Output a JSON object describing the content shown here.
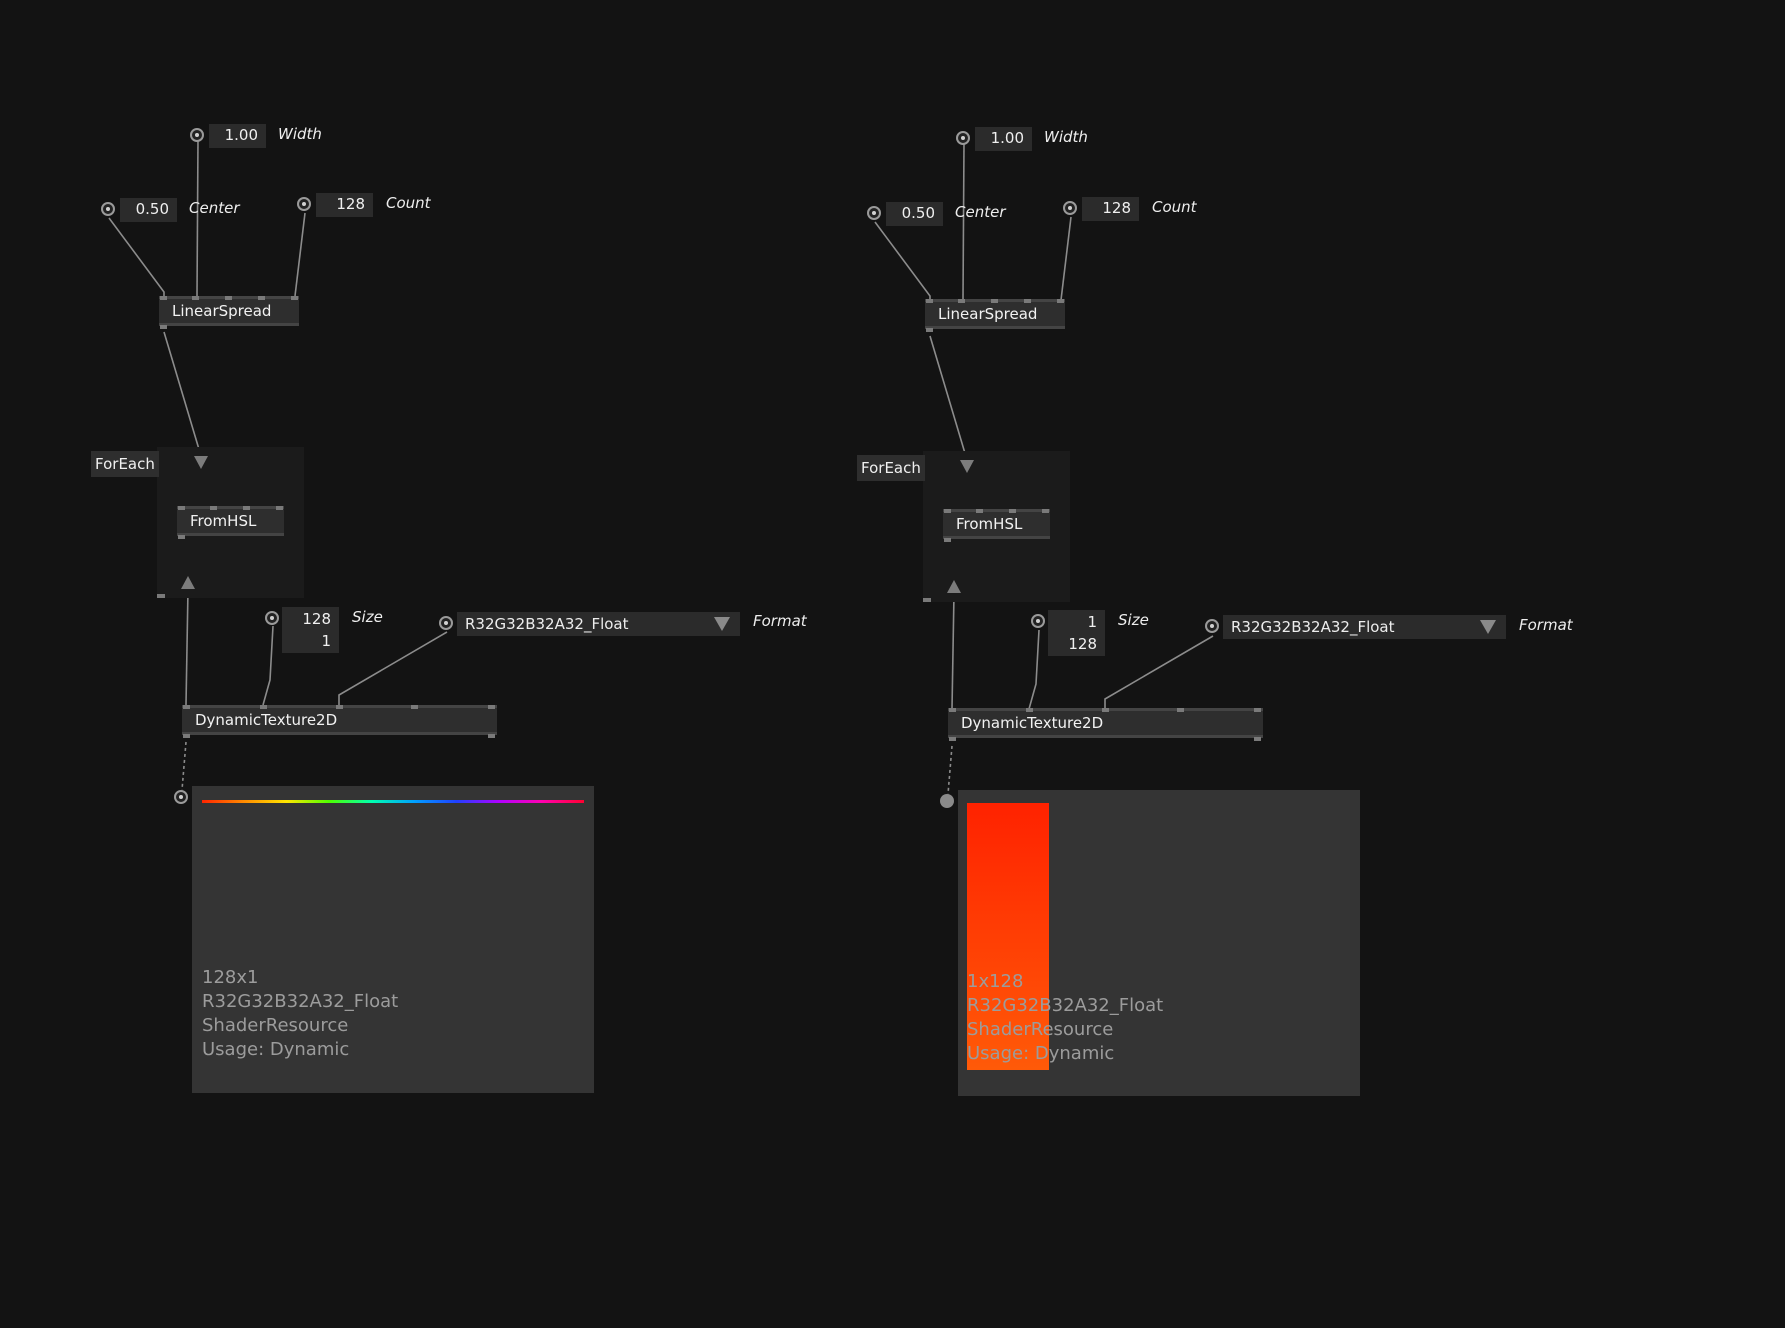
{
  "patches": [
    {
      "width": {
        "value": "1.00",
        "label": "Width"
      },
      "center": {
        "value": "0.50",
        "label": "Center"
      },
      "count": {
        "value": "128",
        "label": "Count"
      },
      "linear_spread": "LinearSpread",
      "foreach": "ForEach",
      "from_hsl": "FromHSL",
      "size": {
        "x": "128",
        "y": "1",
        "label": "Size"
      },
      "format": {
        "value": "R32G32B32A32_Float",
        "label": "Format"
      },
      "dynamic_texture": "DynamicTexture2D",
      "preview": {
        "fill": "rainbow-strip",
        "info": [
          "128x1",
          "R32G32B32A32_Float",
          "ShaderResource",
          "Usage: Dynamic"
        ]
      }
    },
    {
      "width": {
        "value": "1.00",
        "label": "Width"
      },
      "center": {
        "value": "0.50",
        "label": "Center"
      },
      "count": {
        "value": "128",
        "label": "Count"
      },
      "linear_spread": "LinearSpread",
      "foreach": "ForEach",
      "from_hsl": "FromHSL",
      "size": {
        "x": "1",
        "y": "128",
        "label": "Size"
      },
      "format": {
        "value": "R32G32B32A32_Float",
        "label": "Format"
      },
      "dynamic_texture": "DynamicTexture2D",
      "preview": {
        "fill": "red-orange-column",
        "info": [
          "1x128",
          "R32G32B32A32_Float",
          "ShaderResource",
          "Usage: Dynamic"
        ]
      }
    }
  ],
  "colors": {
    "background": "#131313",
    "node": "#2e2e2e",
    "region": "#1b1b1b",
    "wire": "#8c8c8c",
    "preview_panel": "#343434",
    "preview_text": "#9c9c9c",
    "red_column_top": "#ff2200",
    "red_column_bottom": "#ff5a08"
  }
}
